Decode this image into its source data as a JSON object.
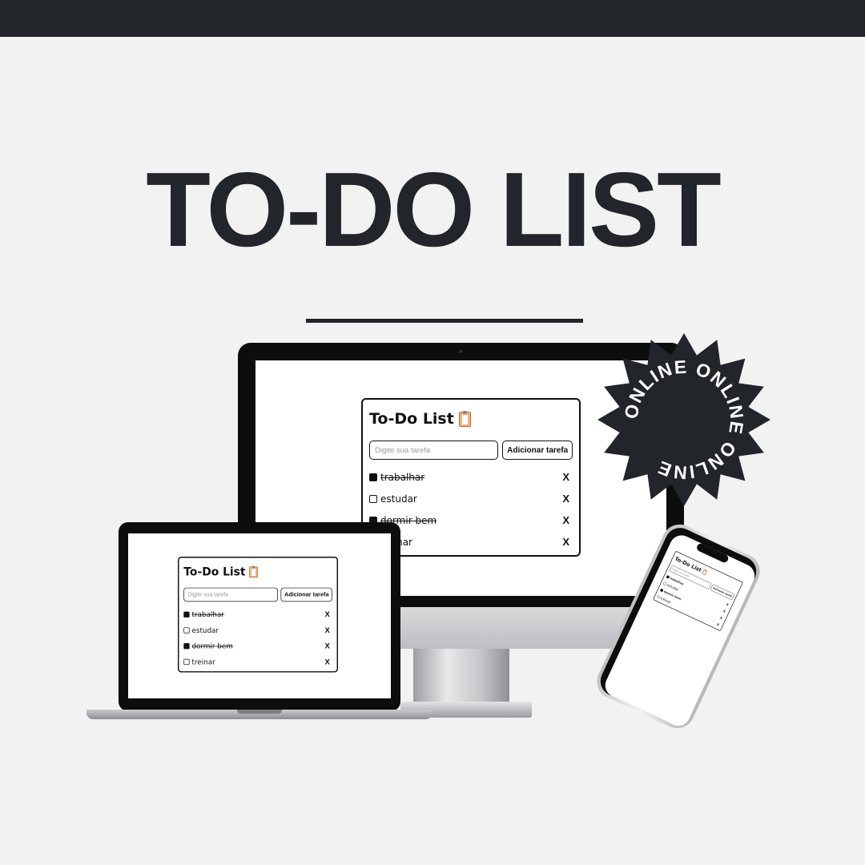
{
  "hero": {
    "title": "TO-DO LIST"
  },
  "badge": {
    "text": "ONLINE ONLINE ONLINE "
  },
  "app": {
    "title": "To-Do List",
    "input_placeholder": "Digite sua tarefa",
    "add_button_label": "Adicionar tarefa",
    "delete_label": "X",
    "tasks": [
      {
        "label": "trabalhar",
        "done": true
      },
      {
        "label": "estudar",
        "done": false
      },
      {
        "label": "dormir bem",
        "done": true
      },
      {
        "label": "treinar",
        "done": false
      }
    ]
  },
  "colors": {
    "background": "#f2f2f2",
    "dark": "#222529",
    "device_black": "#0d0d0d"
  },
  "icons": {
    "title_icon": "clipboard-icon"
  }
}
